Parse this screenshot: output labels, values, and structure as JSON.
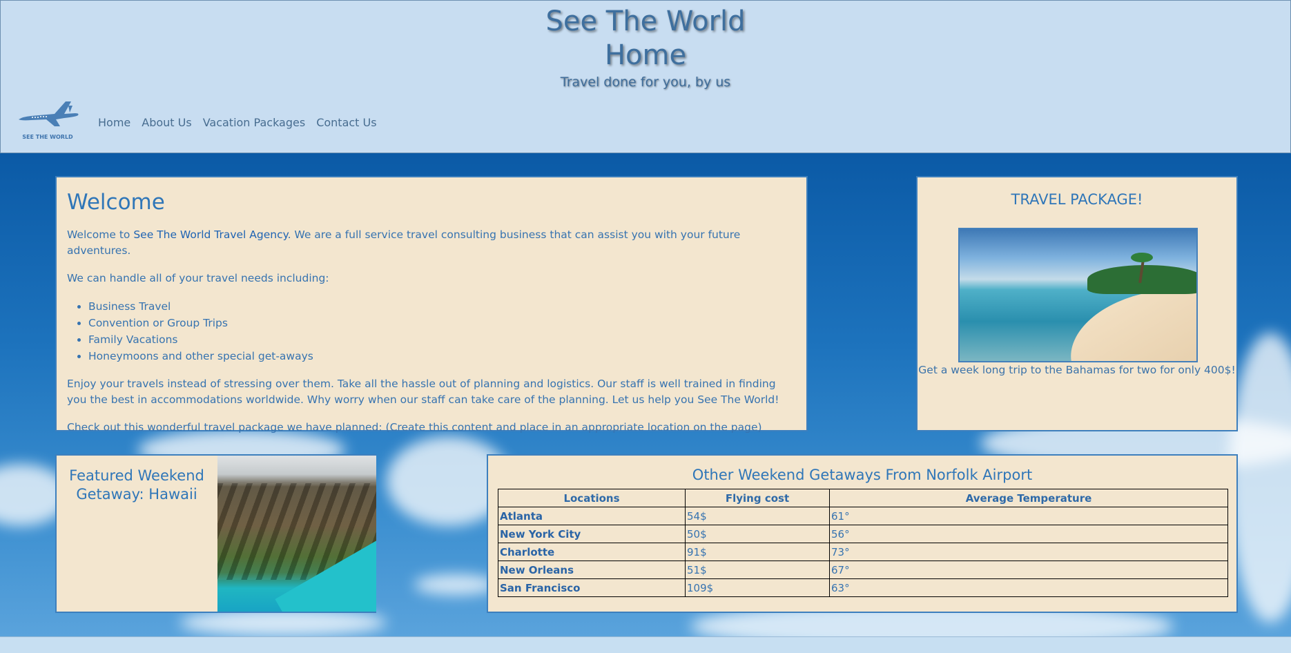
{
  "header": {
    "title_line1": "See The World",
    "title_line2": "Home",
    "tagline": "Travel done for you, by us",
    "logo_text": "SEE THE WORLD",
    "nav": [
      "Home",
      "About Us",
      "Vacation Packages",
      "Contact Us"
    ]
  },
  "welcome": {
    "heading": "Welcome",
    "intro_prefix": "Welcome to ",
    "agency_link": "See The World Travel Agency",
    "intro_suffix": ". We are a full service travel consulting business that can assist you with your future adventures.",
    "needs": "We can handle all of your travel needs including:",
    "services": [
      "Business Travel",
      "Convention or Group Trips",
      "Family Vacations",
      "Honeymoons and other special get-aways"
    ],
    "enjoy": "Enjoy your travels instead of stressing over them. Take all the hassle out of planning and logistics. Our staff is well trained in finding you the best in accommodations worldwide. Why worry when our staff can take care of the planning. Let us help you See The World!",
    "package_note": "Check out this wonderful travel package we have planned: (Create this content and place in an appropriate location on the page)"
  },
  "package": {
    "heading": "TRAVEL PACKAGE!",
    "description": "Get a week long trip to the Bahamas for two for only 400$!"
  },
  "featured": {
    "heading_line1": "Featured Weekend",
    "heading_line2": "Getaway: Hawaii"
  },
  "getaways": {
    "heading": "Other Weekend Getaways From Norfolk Airport",
    "columns": [
      "Locations",
      "Flying cost",
      "Average Temperature"
    ],
    "rows": [
      [
        "Atlanta",
        "54$",
        "61°"
      ],
      [
        "New York City",
        "50$",
        "56°"
      ],
      [
        "Charlotte",
        "91$",
        "73°"
      ],
      [
        "New Orleans",
        "51$",
        "67°"
      ],
      [
        "San Francisco",
        "109$",
        "63°"
      ]
    ]
  },
  "colors": {
    "header_bg": "#c8ddf1",
    "panel_bg": "#f3e6cf",
    "accent_text": "#2f76b8"
  }
}
